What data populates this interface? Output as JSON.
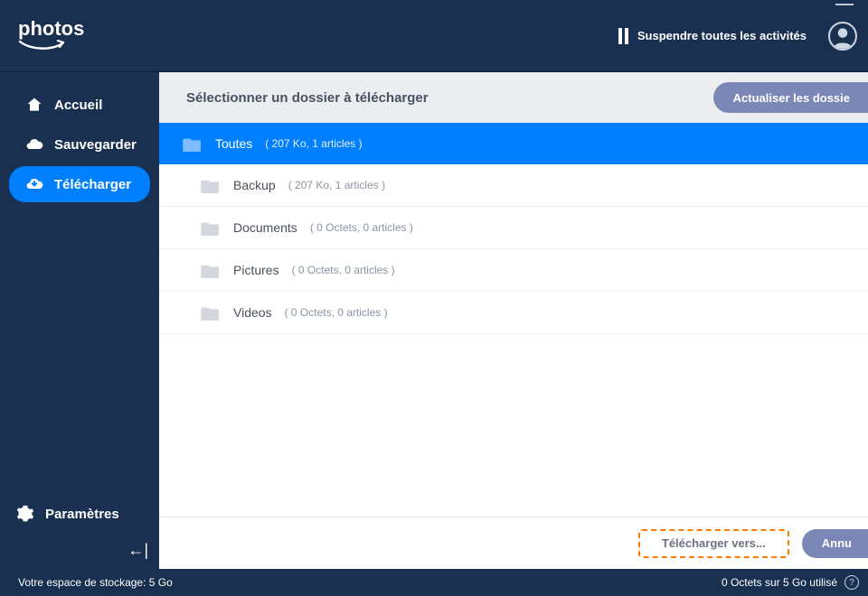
{
  "logo": {
    "text": "photos"
  },
  "header": {
    "suspend_label": "Suspendre toutes les activités"
  },
  "sidebar": {
    "items": [
      {
        "label": "Accueil"
      },
      {
        "label": "Sauvegarder"
      },
      {
        "label": "Télécharger"
      }
    ],
    "settings_label": "Paramètres"
  },
  "subheader": {
    "title": "Sélectionner un dossier à télécharger",
    "refresh_label": "Actualiser les dossie"
  },
  "folders": [
    {
      "name": "Toutes",
      "meta": "( 207 Ko, 1 articles )",
      "selected": true,
      "child": false
    },
    {
      "name": "Backup",
      "meta": "( 207 Ko, 1 articles )",
      "selected": false,
      "child": true
    },
    {
      "name": "Documents",
      "meta": "( 0 Octets, 0 articles )",
      "selected": false,
      "child": true
    },
    {
      "name": "Pictures",
      "meta": "( 0 Octets, 0 articles )",
      "selected": false,
      "child": true
    },
    {
      "name": "Videos",
      "meta": "( 0 Octets, 0 articles )",
      "selected": false,
      "child": true
    }
  ],
  "actions": {
    "download_label": "Télécharger vers...",
    "cancel_label": "Annu"
  },
  "footer": {
    "storage_label": "Votre espace de stockage: 5 Go",
    "usage_label": "0 Octets sur 5 Go utilisé"
  },
  "colors": {
    "brand_dark": "#1a3050",
    "accent_blue": "#0080ff",
    "muted_button": "#7b87b6",
    "dash_orange": "#ff7a00"
  }
}
